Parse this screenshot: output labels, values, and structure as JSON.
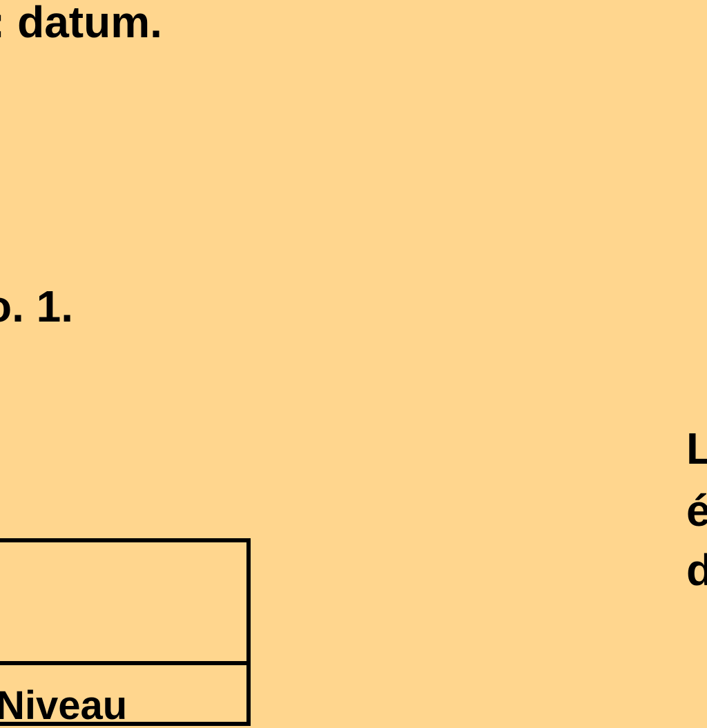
{
  "paragraph_fragment": ": datum.",
  "figure_caption_fragment": "o. 1.",
  "right_column_fragments": [
    "L",
    "é",
    "d"
  ],
  "table": {
    "cell_fragment": "Niveau"
  }
}
